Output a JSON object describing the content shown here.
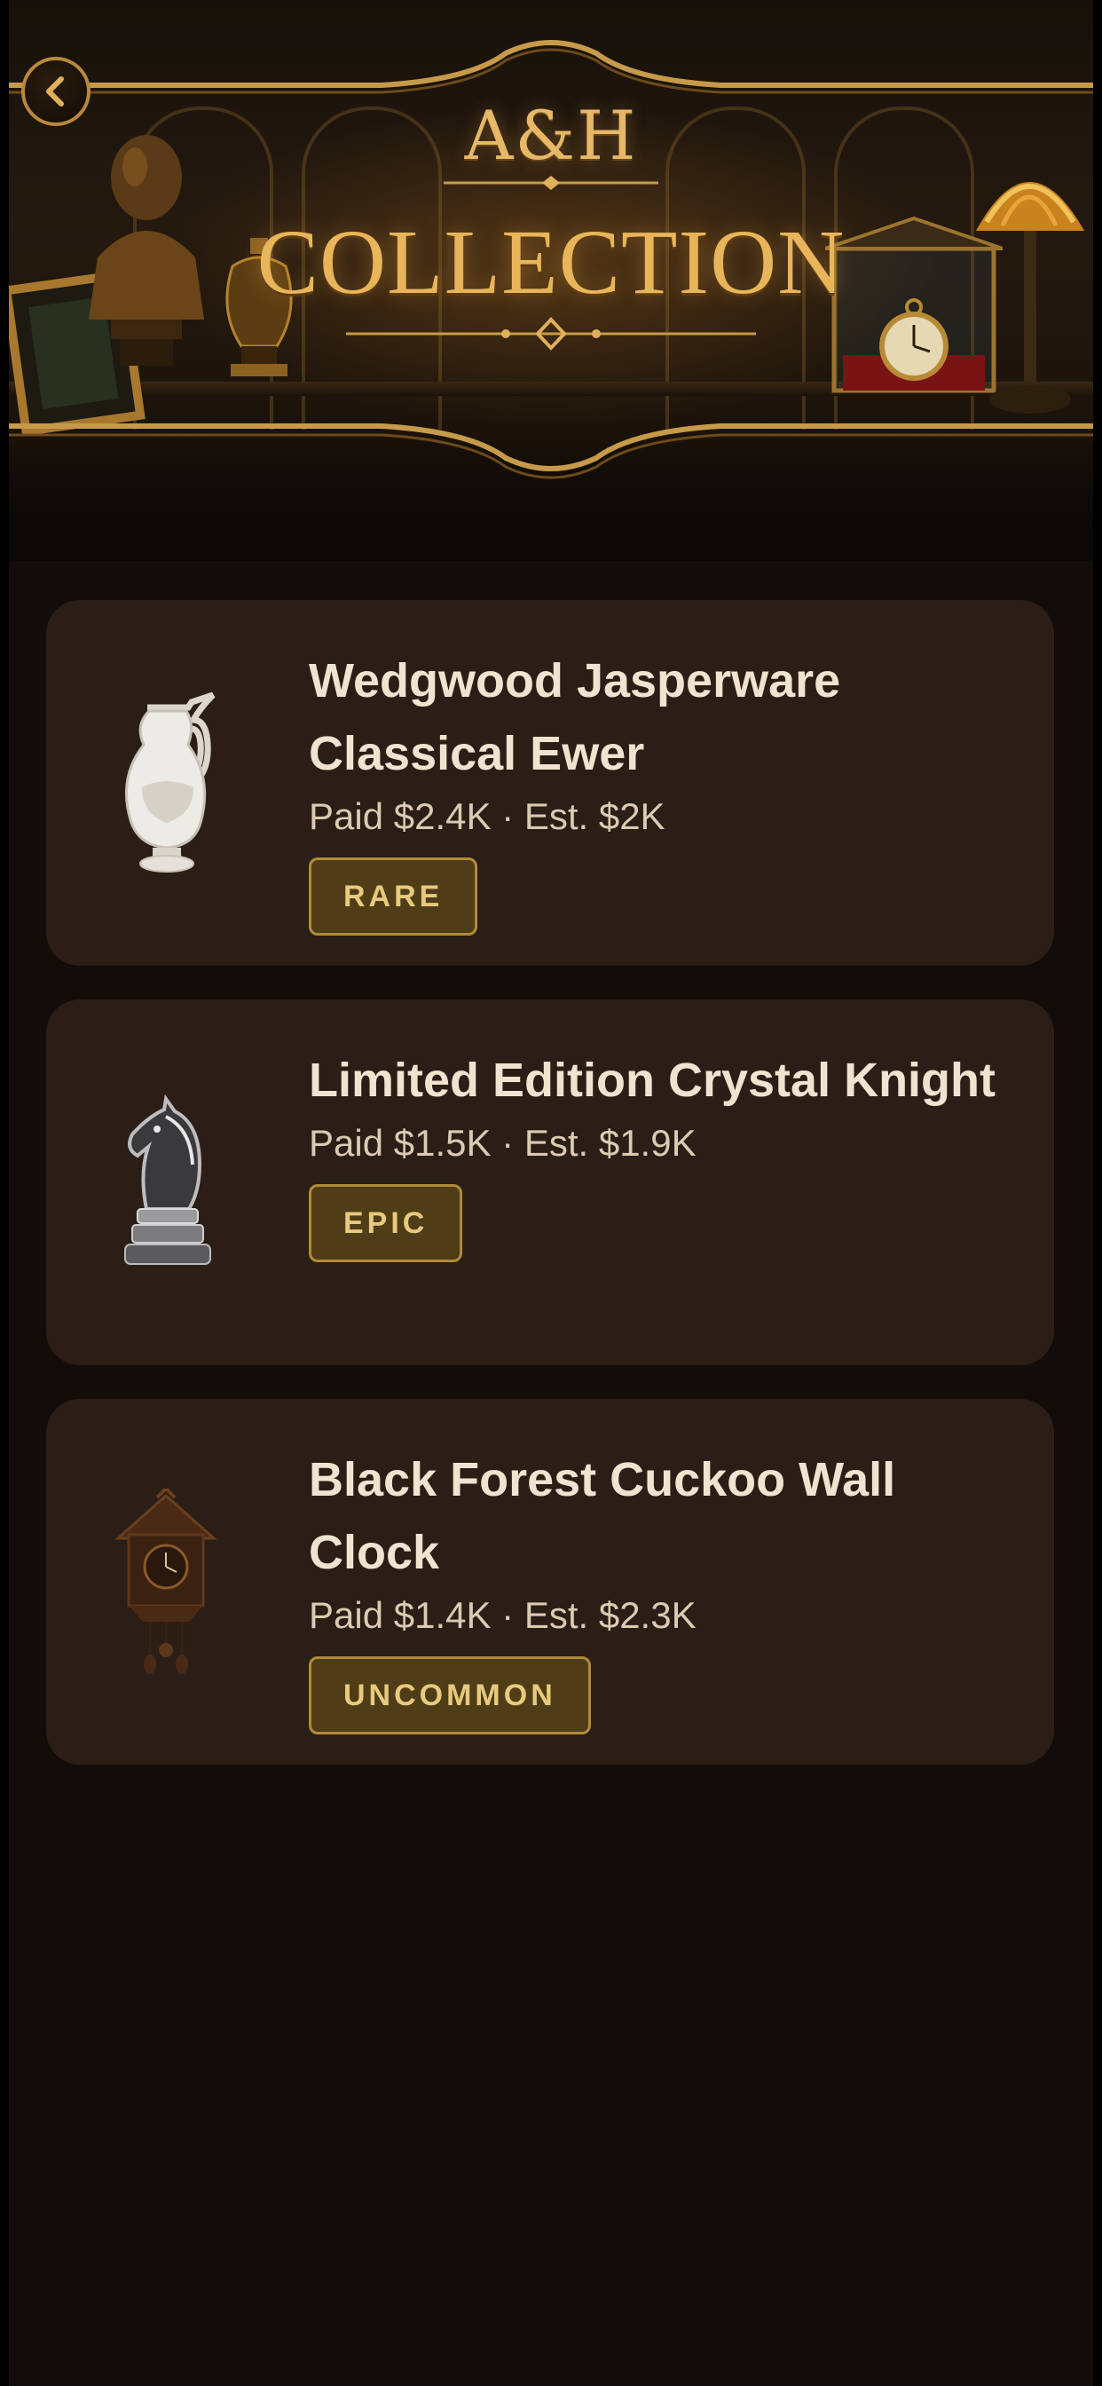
{
  "header": {
    "brand": "A&H",
    "title": "COLLECTION",
    "back_icon": "chevron-left-icon",
    "accent_color": "#e8b55a"
  },
  "collection": {
    "items": [
      {
        "name": "Wedgwood Jasperware Classical Ewer",
        "price": "Paid $2.4K · Est. $2K",
        "rarity": "RARE",
        "image": "ewer-image"
      },
      {
        "name": "Limited Edition Crystal Knight",
        "price": "Paid $1.5K · Est. $1.9K",
        "rarity": "EPIC",
        "image": "chess-knight-image"
      },
      {
        "name": "Black Forest Cuckoo Wall Clock",
        "price": "Paid $1.4K · Est. $2.3K",
        "rarity": "UNCOMMON",
        "image": "cuckoo-clock-image"
      }
    ]
  },
  "colors": {
    "background": "#130d09",
    "card": "#2a1e16",
    "badge_fill": "#4e3d17",
    "badge_border": "#b28b3a",
    "badge_text": "#e8ca7e",
    "title_text": "#f1e3cf"
  }
}
